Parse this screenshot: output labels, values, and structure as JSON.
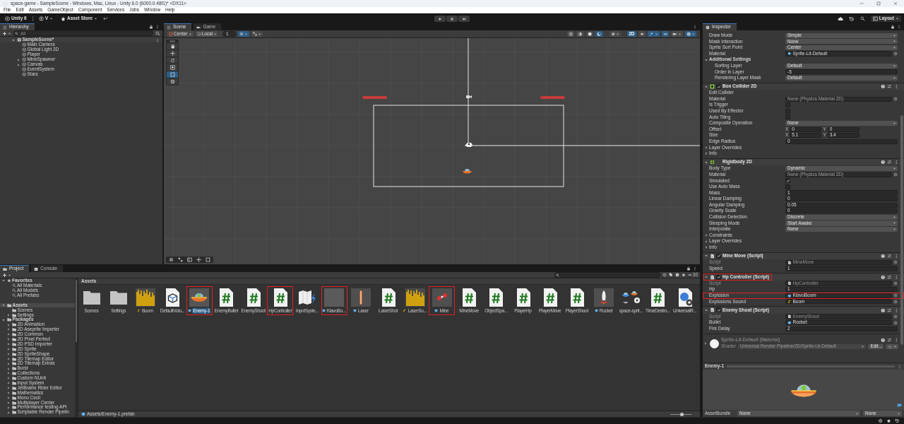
{
  "window": {
    "title": "space-game - SampleScene - Windows, Mac, Linux - Unity 6.0 (6000.0.48f1)* <DX11>"
  },
  "menu": [
    "File",
    "Edit",
    "Assets",
    "GameObject",
    "Component",
    "Services",
    "Jobs",
    "Window",
    "Help"
  ],
  "toolbar": {
    "account": "Unity 6",
    "user": "V",
    "store": "Asset Store",
    "layout": "Layout"
  },
  "hierarchy": {
    "title": "Hierarchy",
    "search": {
      "placeholder": "All"
    },
    "items": [
      {
        "label": "SampleScene*",
        "kind": "scene",
        "expanded": true,
        "children": [
          {
            "label": "Main Camera"
          },
          {
            "label": "Global Light 2D"
          },
          {
            "label": "Player"
          },
          {
            "label": "MineSpawner",
            "expanded": false
          },
          {
            "label": "Canvas",
            "expanded": false
          },
          {
            "label": "EventSystem"
          },
          {
            "label": "Stars"
          }
        ]
      }
    ]
  },
  "scene": {
    "tabs": [
      {
        "label": "Scene",
        "selected": true
      },
      {
        "label": "Game",
        "selected": false
      }
    ],
    "pivot": "Center",
    "space": "Local",
    "grid_size": "1",
    "snap": [
      {
        "kind": "grid",
        "selected": true
      },
      {
        "kind": "increment",
        "selected": false
      }
    ],
    "view_buttons": [
      {
        "kind": "globe",
        "selected": false
      },
      {
        "kind": "shading",
        "selected": false
      },
      {
        "kind": "lit",
        "selected": false
      },
      {
        "kind": "orbit",
        "selected": true
      },
      {
        "kind": "light",
        "selected": false
      },
      {
        "kind": "mode",
        "label": "2D",
        "selected": true
      },
      {
        "kind": "audio",
        "selected": false
      },
      {
        "kind": "effects",
        "selected": true
      },
      {
        "kind": "visibility",
        "selected": true
      },
      {
        "kind": "camera",
        "selected": false
      },
      {
        "kind": "gizmo",
        "selected": true
      }
    ],
    "tools": [
      {
        "kind": "hand",
        "selected": false
      },
      {
        "kind": "move",
        "selected": false
      },
      {
        "kind": "rotate",
        "selected": false
      },
      {
        "kind": "scale",
        "selected": false
      },
      {
        "kind": "rect",
        "selected": true
      },
      {
        "kind": "transform",
        "selected": false
      }
    ]
  },
  "inspector": {
    "title": "Inspector",
    "sections": [
      {
        "kind": "rows",
        "rows": [
          {
            "label": "Draw Mode",
            "kind": "dropdown",
            "value": "Simple"
          },
          {
            "label": "Mask Interaction",
            "kind": "dropdown",
            "value": "None"
          },
          {
            "label": "Sprite Sort Point",
            "kind": "dropdown",
            "value": "Center"
          },
          {
            "label": "Material",
            "kind": "material",
            "value": "Sprite-Lit-Default"
          },
          {
            "label": "Additional Settings",
            "kind": "foldout",
            "expanded": true,
            "children": [
              {
                "label": "Sorting Layer",
                "kind": "dropdown",
                "value": "Default"
              },
              {
                "label": "Order in Layer",
                "kind": "field",
                "value": "-5"
              },
              {
                "label": "Rendering Layer Mask",
                "kind": "dropdown",
                "value": "Default"
              }
            ]
          }
        ]
      },
      {
        "kind": "collider",
        "title": "Box Collider 2D",
        "expanded": true,
        "enabled": true,
        "highlighted": false,
        "rows": [
          {
            "label": "Edit Collider",
            "kind": "label"
          },
          {
            "label": "Material",
            "kind": "object",
            "value": "None (Physics Material 2D)"
          },
          {
            "label": "Is Trigger",
            "kind": "checkbox",
            "checked": false
          },
          {
            "label": "Used By Effector",
            "kind": "checkbox",
            "checked": false
          },
          {
            "label": "Auto Tiling",
            "kind": "checkbox",
            "checked": false
          },
          {
            "label": "Composite Operation",
            "kind": "dropdown",
            "value": "None"
          },
          {
            "label": "Offset",
            "kind": "vector",
            "components": [
              {
                "axis": "X",
                "value": "0"
              },
              {
                "axis": "Y",
                "value": "0"
              }
            ]
          },
          {
            "label": "Size",
            "kind": "vector",
            "components": [
              {
                "axis": "X",
                "value": "5.1"
              },
              {
                "axis": "Y",
                "value": "3.4"
              }
            ]
          },
          {
            "label": "Edge Radius",
            "kind": "field",
            "value": "0"
          },
          {
            "label": "Layer Overrides",
            "kind": "foldout",
            "expanded": false
          },
          {
            "label": "Info",
            "kind": "foldout",
            "expanded": false
          }
        ]
      },
      {
        "kind": "rigidbody",
        "title": "Rigidbody 2D",
        "expanded": true,
        "highlighted": false,
        "rows": [
          {
            "label": "Body Type",
            "kind": "dropdown",
            "value": "Dynamic"
          },
          {
            "label": "Material",
            "kind": "object",
            "value": "None (Physics Material 2D)"
          },
          {
            "label": "Simulated",
            "kind": "checkbox",
            "checked": true
          },
          {
            "label": "Use Auto Mass",
            "kind": "checkbox",
            "checked": false
          },
          {
            "label": "Mass",
            "kind": "field",
            "value": "1"
          },
          {
            "label": "Linear Damping",
            "kind": "field",
            "value": "0"
          },
          {
            "label": "Angular Damping",
            "kind": "field",
            "value": "0.05"
          },
          {
            "label": "Gravity Scale",
            "kind": "field",
            "value": "0"
          },
          {
            "label": "Collision Detection",
            "kind": "dropdown",
            "value": "Discrete"
          },
          {
            "label": "Sleeping Mode",
            "kind": "dropdown",
            "value": "Start Awake"
          },
          {
            "label": "Interpolate",
            "kind": "dropdown",
            "value": "None"
          },
          {
            "label": "Constraints",
            "kind": "foldout",
            "expanded": false
          },
          {
            "label": "Layer Overrides",
            "kind": "foldout",
            "expanded": false
          },
          {
            "label": "Info",
            "kind": "foldout",
            "expanded": false
          }
        ]
      },
      {
        "kind": "script",
        "title": "Mine Move (Script)",
        "expanded": true,
        "enabled": true,
        "highlighted": false,
        "rows": [
          {
            "label": "Script",
            "kind": "script",
            "value": "MineMove",
            "disabled": true
          },
          {
            "label": "Speed",
            "kind": "field",
            "value": "1"
          }
        ]
      },
      {
        "kind": "script",
        "title": "Hp Controller (Script)",
        "expanded": true,
        "enabled": true,
        "highlighted": true,
        "rows": [
          {
            "label": "Script",
            "kind": "script",
            "value": "HpController",
            "disabled": true,
            "highlighted": false
          },
          {
            "label": "Hp",
            "kind": "field",
            "value": "1",
            "highlighted": false
          },
          {
            "label": "Explosion",
            "kind": "prefab",
            "value": "KlavoBoom",
            "highlighted": true
          },
          {
            "label": "Explosions Sound",
            "kind": "audio",
            "value": "Boom",
            "highlighted": false
          }
        ]
      },
      {
        "kind": "script",
        "title": "Enemy Shoot (Script)",
        "expanded": true,
        "enabled": true,
        "highlighted": false,
        "rows": [
          {
            "label": "Script",
            "kind": "script",
            "value": "EnemyShoot",
            "disabled": true
          },
          {
            "label": "Bullet",
            "kind": "prefab",
            "value": "Rocket"
          },
          {
            "label": "Fire Delay",
            "kind": "field",
            "value": "2"
          }
        ]
      },
      {
        "kind": "material",
        "title": "Sprite-Lit-Default (Material)",
        "shader_label": "Shader",
        "shader": "Universal Render Pipeline/2D/Sprite-Lit-Default",
        "edit": "Edit...",
        "expanded": false
      }
    ],
    "preview": {
      "title": "Enemy-1"
    },
    "asset_bundle": {
      "label": "AssetBundle",
      "name": "None",
      "variant": "None"
    }
  },
  "project": {
    "tabs": [
      {
        "label": "Project",
        "selected": true
      },
      {
        "label": "Console",
        "selected": false
      }
    ],
    "tree": [
      {
        "label": "Favorites",
        "kind": "favorites",
        "expanded": true,
        "selected": false,
        "children": [
          {
            "label": "All Materials",
            "kind": "search"
          },
          {
            "label": "All Models",
            "kind": "search"
          },
          {
            "label": "All Prefabs",
            "kind": "search"
          }
        ]
      },
      {
        "label": "Assets",
        "kind": "folder",
        "expanded": true,
        "selected": true,
        "children": [
          {
            "label": "Scenes",
            "kind": "folder"
          },
          {
            "label": "Settings",
            "kind": "folder",
            "expanded": false
          }
        ]
      },
      {
        "label": "Packages",
        "kind": "folder",
        "expanded": true,
        "selected": false,
        "children": [
          {
            "label": "2D Animation",
            "kind": "folder",
            "expanded": false
          },
          {
            "label": "2D Aseprite Importer",
            "kind": "folder",
            "expanded": false
          },
          {
            "label": "2D Common",
            "kind": "folder",
            "expanded": false
          },
          {
            "label": "2D Pixel Perfect",
            "kind": "folder",
            "expanded": false
          },
          {
            "label": "2D PSD Importer",
            "kind": "folder",
            "expanded": false
          },
          {
            "label": "2D Sprite",
            "kind": "folder",
            "expanded": false
          },
          {
            "label": "2D SpriteShape",
            "kind": "folder",
            "expanded": false
          },
          {
            "label": "2D Tilemap Editor",
            "kind": "folder",
            "expanded": false
          },
          {
            "label": "2D Tilemap Extras",
            "kind": "folder",
            "expanded": false
          },
          {
            "label": "Burst",
            "kind": "folder",
            "expanded": false
          },
          {
            "label": "Collections",
            "kind": "folder",
            "expanded": false
          },
          {
            "label": "Custom NUnit",
            "kind": "folder",
            "expanded": false
          },
          {
            "label": "Input System",
            "kind": "folder",
            "expanded": false
          },
          {
            "label": "JetBrains Rider Editor",
            "kind": "folder",
            "expanded": false
          },
          {
            "label": "Mathematics",
            "kind": "folder",
            "expanded": false
          },
          {
            "label": "Mono Cecil",
            "kind": "folder",
            "expanded": false
          },
          {
            "label": "Multiplayer Center",
            "kind": "folder",
            "expanded": false
          },
          {
            "label": "Performance testing API",
            "kind": "folder",
            "expanded": false
          },
          {
            "label": "Scriptable Render Pipelin",
            "kind": "folder",
            "expanded": false
          }
        ]
      }
    ],
    "breadcrumb": "Assets",
    "count": "30",
    "assets": [
      {
        "label": "Scenes",
        "kind": "folder",
        "selected": false,
        "highlighted": false
      },
      {
        "label": "Settings",
        "kind": "folder",
        "selected": false,
        "highlighted": false
      },
      {
        "label": "Boom",
        "kind": "audio",
        "selected": false,
        "highlighted": false
      },
      {
        "label": "DefaultVolu...",
        "kind": "volume",
        "selected": false,
        "highlighted": false
      },
      {
        "label": "Enemy-1",
        "kind": "ufo",
        "selected": true,
        "highlighted": true
      },
      {
        "label": "EnemyBullet",
        "kind": "script",
        "selected": false,
        "highlighted": false
      },
      {
        "label": "EnemyShoot",
        "kind": "script",
        "selected": false,
        "highlighted": false
      },
      {
        "label": "HpController",
        "kind": "script",
        "selected": false,
        "highlighted": true
      },
      {
        "label": "InputSyste...",
        "kind": "input",
        "selected": false,
        "highlighted": false
      },
      {
        "label": "KlavoBo...",
        "kind": "effect",
        "selected": false,
        "highlighted": true
      },
      {
        "label": "Laser",
        "kind": "laser",
        "selected": false,
        "highlighted": false
      },
      {
        "label": "LaserShot",
        "kind": "script",
        "selected": false,
        "highlighted": false
      },
      {
        "label": "LaserSo...",
        "kind": "audio",
        "selected": false,
        "highlighted": false
      },
      {
        "label": "Mine",
        "kind": "mine",
        "selected": false,
        "highlighted": true
      },
      {
        "label": "MineMove",
        "kind": "script",
        "selected": false,
        "highlighted": false
      },
      {
        "label": "ObjectSpa...",
        "kind": "script",
        "selected": false,
        "highlighted": false
      },
      {
        "label": "PlayerHp",
        "kind": "script",
        "selected": false,
        "highlighted": false
      },
      {
        "label": "PlayerMove",
        "kind": "script",
        "selected": false,
        "highlighted": false
      },
      {
        "label": "PlayerShoot",
        "kind": "script",
        "selected": false,
        "highlighted": false
      },
      {
        "label": "Rocket",
        "kind": "rocket",
        "selected": false,
        "highlighted": false
      },
      {
        "label": "space-sprit...",
        "kind": "sheet",
        "selected": false,
        "highlighted": false
      },
      {
        "label": "TimeDestro...",
        "kind": "script",
        "selected": false,
        "highlighted": false
      },
      {
        "label": "UniversalR...",
        "kind": "pipeline",
        "selected": false,
        "highlighted": false
      }
    ],
    "path": "Assets/Enemy-1.prefab",
    "zoom": {
      "level": 0.55
    }
  }
}
